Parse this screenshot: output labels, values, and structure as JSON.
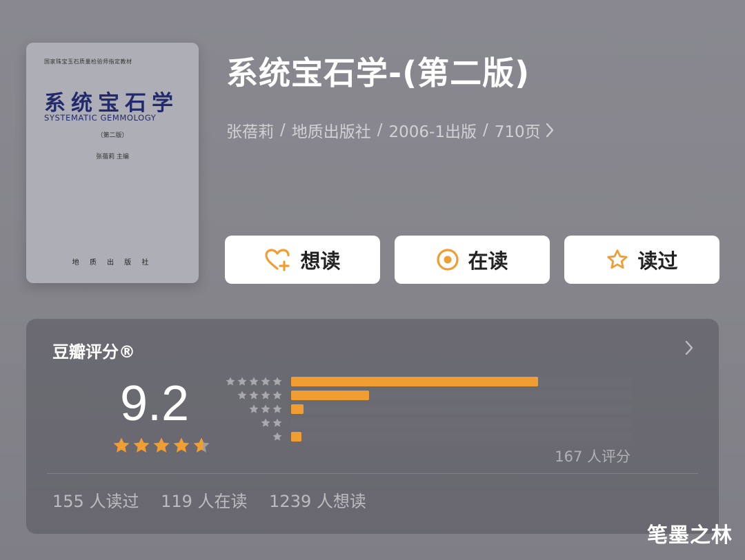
{
  "cover": {
    "series": "国家珠宝玉石质量检验师指定教材",
    "title": "系统宝石学",
    "english_title": "SYSTEMATIC GEMMOLOGY",
    "edition": "（第二版）",
    "author": "张蓓莉 主编",
    "publisher": "地 质 出 版 社"
  },
  "book": {
    "title": "系统宝石学-(第二版)",
    "author": "张蓓莉",
    "publisher": "地质出版社",
    "publish_date": "2006-1出版",
    "pages": "710页",
    "separator": "/"
  },
  "actions": {
    "want": "想读",
    "reading": "在读",
    "read": "读过"
  },
  "rating": {
    "header": "豆瓣评分®",
    "score": "9.2",
    "stars": 4.6,
    "distribution": [
      {
        "stars": 5,
        "fraction": 0.725
      },
      {
        "stars": 4,
        "fraction": 0.228
      },
      {
        "stars": 3,
        "fraction": 0.036
      },
      {
        "stars": 2,
        "fraction": 0.0
      },
      {
        "stars": 1,
        "fraction": 0.03
      }
    ],
    "count_label": "167 人评分",
    "stats": {
      "read": "155 人读过",
      "reading": "119 人在读",
      "want": "1239 人想读"
    }
  },
  "watermark": "笔墨之林",
  "colors": {
    "accent": "#f09e32",
    "background": "#86858c",
    "button_bg": "#ffffff"
  },
  "icons": {
    "want": "heart-plus-icon",
    "reading": "target-circle-icon",
    "read": "star-outline-icon",
    "meta_more": "chevron-right-icon",
    "rating_more": "chevron-right-icon"
  }
}
